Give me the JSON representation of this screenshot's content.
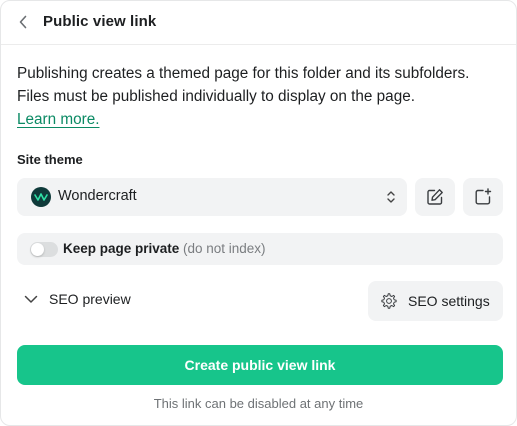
{
  "header": {
    "title": "Public view link"
  },
  "description": {
    "line1": "Publishing creates a themed page for this folder and its subfolders.",
    "line2": "Files must be published individually to display on the page.",
    "learn_more": "Learn more."
  },
  "site_theme": {
    "label": "Site theme",
    "selected": "Wondercraft"
  },
  "privacy": {
    "label": "Keep page private",
    "hint": "(do not index)",
    "enabled": false
  },
  "seo": {
    "preview_label": "SEO preview",
    "settings_label": "SEO settings"
  },
  "actions": {
    "create_label": "Create public view link",
    "footnote": "This link can be disabled at any time"
  },
  "colors": {
    "accent": "#17c58b",
    "link": "#0b8a64",
    "surface": "#f2f3f4"
  }
}
